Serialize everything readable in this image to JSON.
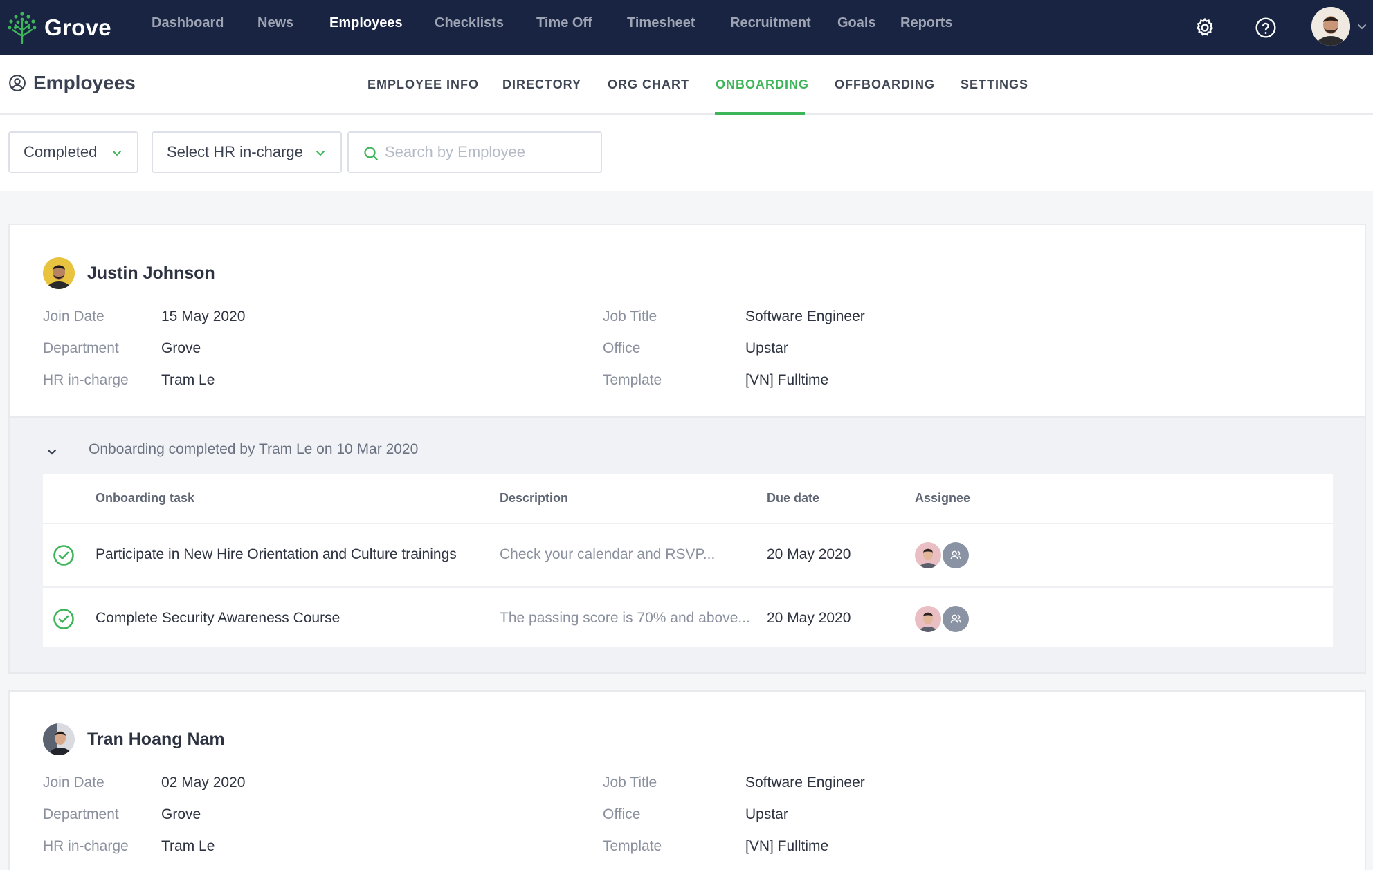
{
  "app": {
    "name": "Grove"
  },
  "topnav": {
    "items": [
      {
        "label": "Dashboard"
      },
      {
        "label": "News"
      },
      {
        "label": "Employees"
      },
      {
        "label": "Checklists"
      },
      {
        "label": "Time Off"
      },
      {
        "label": "Timesheet"
      },
      {
        "label": "Recruitment"
      },
      {
        "label": "Goals"
      },
      {
        "label": "Reports"
      }
    ],
    "active": "Employees"
  },
  "subheader": {
    "title": "Employees",
    "tabs": [
      {
        "label": "EMPLOYEE INFO"
      },
      {
        "label": "DIRECTORY"
      },
      {
        "label": "ORG CHART"
      },
      {
        "label": "ONBOARDING"
      },
      {
        "label": "OFFBOARDING"
      },
      {
        "label": "SETTINGS"
      }
    ],
    "active_tab": "ONBOARDING"
  },
  "filters": {
    "status_value": "Completed",
    "hr_value": "Select HR in-charge",
    "search_placeholder": "Search by Employee"
  },
  "labels": {
    "join_date": "Join Date",
    "department": "Department",
    "hr_in_charge": "HR in-charge",
    "job_title": "Job Title",
    "office": "Office",
    "template": "Template"
  },
  "table_headers": {
    "task": "Onboarding task",
    "description": "Description",
    "due_date": "Due date",
    "assignee": "Assignee"
  },
  "employees": [
    {
      "name": "Justin Johnson",
      "join_date": "15 May 2020",
      "department": "Grove",
      "hr_in_charge": "Tram Le",
      "job_title": "Software Engineer",
      "office": "Upstar",
      "template": "[VN] Fulltime",
      "onboarding_summary": "Onboarding completed by Tram Le on 10 Mar 2020",
      "tasks": [
        {
          "name": "Participate in New Hire Orientation and Culture trainings",
          "description": "Check your calendar and RSVP...",
          "due": "20 May 2020"
        },
        {
          "name": "Complete Security Awareness Course",
          "description": "The passing score is 70% and above...",
          "due": "20 May 2020"
        }
      ]
    },
    {
      "name": "Tran Hoang Nam",
      "join_date": "02 May 2020",
      "department": "Grove",
      "hr_in_charge": "Tram Le",
      "job_title": "Software Engineer",
      "office": "Upstar",
      "template": "[VN] Fulltime"
    }
  ],
  "colors": {
    "nav_bg": "#182441",
    "accent": "#3fb55a",
    "page_bg": "#f5f6f8"
  }
}
